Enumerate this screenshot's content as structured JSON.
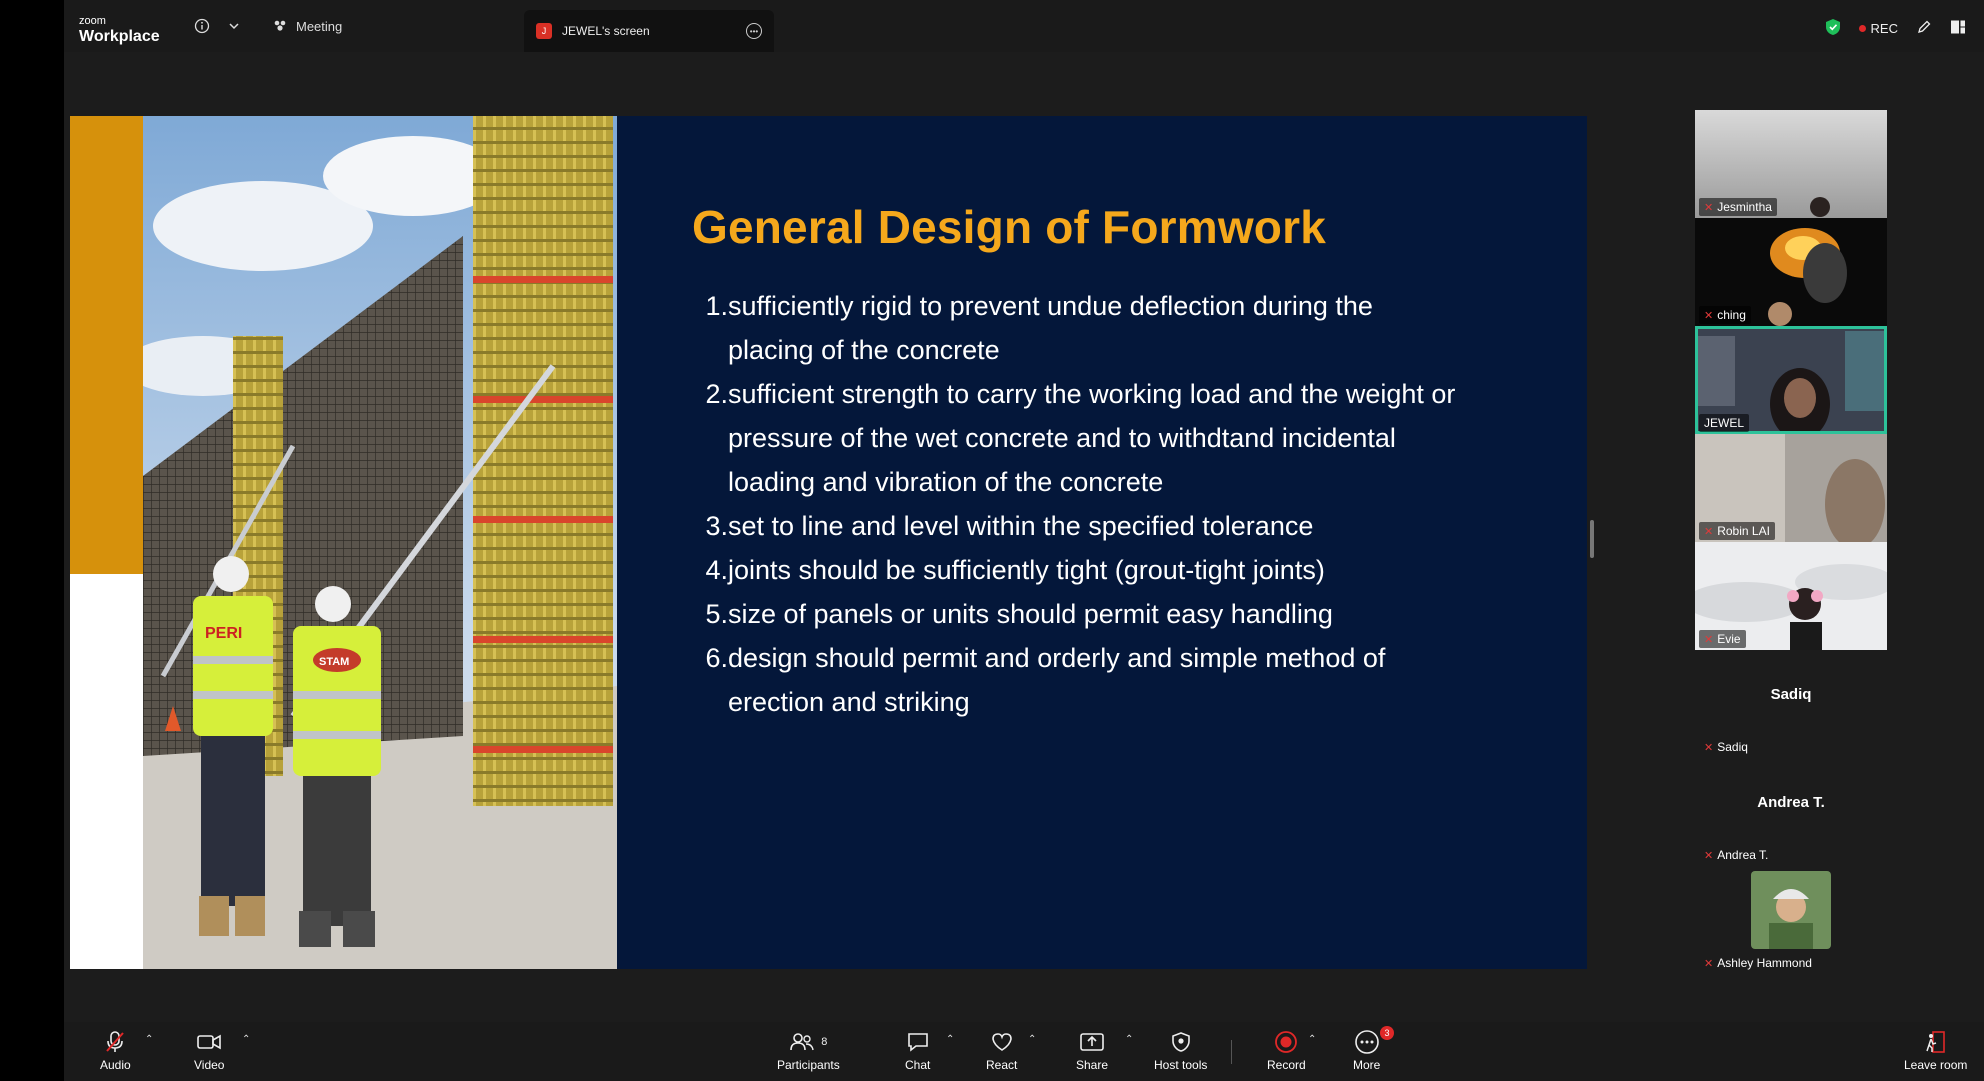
{
  "app": {
    "brand_small": "zoom",
    "brand_large": "Workplace"
  },
  "topbar": {
    "meeting_label": "Meeting",
    "screen_tab_label": "JEWEL's screen",
    "screen_tab_initial": "J",
    "rec_label": "REC"
  },
  "slide": {
    "title": "General Design of Formwork",
    "items": [
      {
        "num": "1.",
        "text": "sufficiently rigid to prevent undue deflection during the placing of the concrete"
      },
      {
        "num": "2.",
        "text": "sufficient strength to carry the working load and the weight or pressure of the wet concrete and to withdtand incidental loading and vibration of the concrete"
      },
      {
        "num": "3.",
        "text": "set to line and level within the specified tolerance"
      },
      {
        "num": "4.",
        "text": "joints should be sufficiently tight (grout-tight joints)"
      },
      {
        "num": "5.",
        "text": "size of panels or units should permit easy handling"
      },
      {
        "num": "6.",
        "text": "design should permit and orderly and simple method of erection and striking"
      }
    ],
    "photo_vest_left": "PERI",
    "photo_vest_right": "STAM"
  },
  "participants": [
    {
      "name": "Jesmintha"
    },
    {
      "name": "ching"
    },
    {
      "name": "JEWEL"
    },
    {
      "name": "Robin LAI"
    },
    {
      "name": "Evie"
    },
    {
      "name": "Sadiq",
      "display": "Sadiq"
    },
    {
      "name": "Andrea T.",
      "display": "Andrea T."
    },
    {
      "name": "Ashley Hammond"
    }
  ],
  "toolbar": {
    "audio": "Audio",
    "video": "Video",
    "participants": "Participants",
    "participants_count": "8",
    "chat": "Chat",
    "react": "React",
    "share": "Share",
    "host_tools": "Host tools",
    "record": "Record",
    "more": "More",
    "more_badge": "3",
    "leave": "Leave room"
  },
  "colors": {
    "slide_bg": "#04173a",
    "title": "#f5a81c",
    "accent_bar": "#d6910c",
    "active_speaker": "#2dc29a",
    "record_red": "#e02828"
  },
  "icons": [
    "info-icon",
    "chevron-down-icon",
    "meeting-icon",
    "more-options-icon",
    "shield-icon",
    "pen-icon",
    "layout-icon",
    "mic-muted-icon",
    "video-camera-icon",
    "participants-icon",
    "chat-icon",
    "react-icon",
    "share-icon",
    "host-tools-icon",
    "record-icon",
    "more-icon",
    "leave-icon"
  ]
}
